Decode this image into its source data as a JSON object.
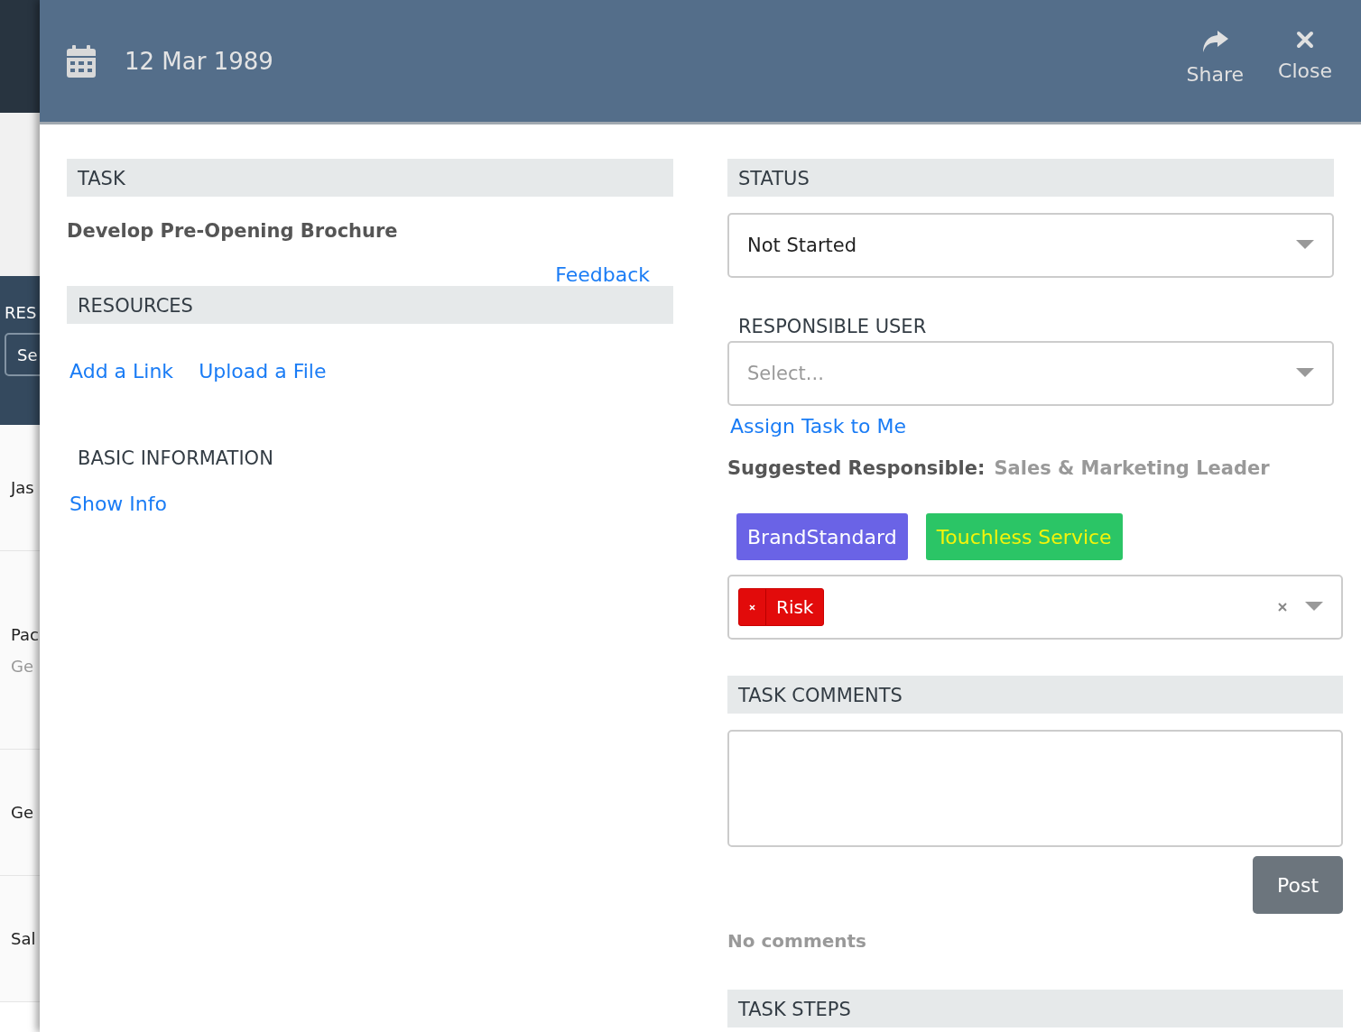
{
  "background_page": {
    "section_label": "RES",
    "search_placeholder": "Se",
    "rows": [
      {
        "title": "Jas"
      },
      {
        "title": "Pac",
        "subtitle": "Ge"
      },
      {
        "title": "Ge"
      },
      {
        "title": "Sal"
      }
    ]
  },
  "panel": {
    "date": "12 Mar 1989",
    "actions": [
      {
        "kind": "share",
        "label": "Share"
      },
      {
        "kind": "close",
        "label": "Close"
      }
    ]
  },
  "task": {
    "heading": "TASK",
    "name": "Develop Pre-Opening Brochure",
    "feedback_link": "Feedback"
  },
  "resources": {
    "heading": "RESOURCES",
    "links": [
      "Add a Link",
      "Upload a File"
    ]
  },
  "basic_information": {
    "heading": "BASIC INFORMATION",
    "link": "Show Info"
  },
  "status": {
    "heading": "STATUS",
    "value": "Not Started"
  },
  "responsible_user": {
    "heading": "RESPONSIBLE USER",
    "placeholder": "Select...",
    "assign_link": "Assign Task to Me",
    "suggested_label": "Suggested Responsible:",
    "suggested_value": "Sales & Marketing Leader"
  },
  "tags": [
    {
      "label": "BrandStandard",
      "color": "#6a63e6",
      "kind": "plain"
    },
    {
      "label": "Touchless Service",
      "color": "#2bc566",
      "kind": "highlighted"
    }
  ],
  "selected_tags": [
    {
      "label": "Risk",
      "color": "#e20b0b"
    }
  ],
  "comments": {
    "heading": "TASK COMMENTS",
    "post_button": "Post",
    "empty_text": "No comments"
  },
  "task_steps": {
    "heading": "TASK STEPS"
  }
}
